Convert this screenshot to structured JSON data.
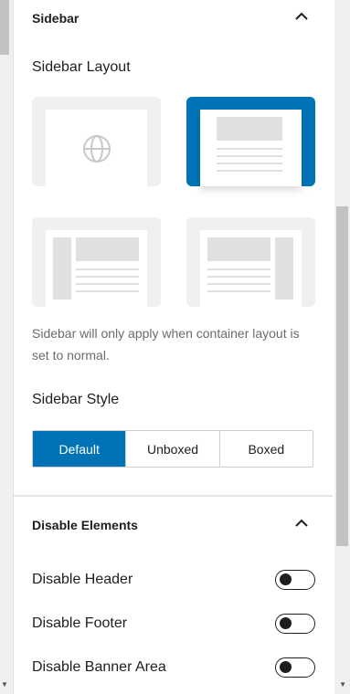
{
  "sidebar_section": {
    "title": "Sidebar",
    "layout_label": "Sidebar Layout",
    "layout_options": [
      {
        "name": "default",
        "icon": "globe-icon",
        "selected": false
      },
      {
        "name": "no-sidebar",
        "icon": "",
        "selected": true
      },
      {
        "name": "left-sidebar",
        "icon": "",
        "selected": false
      },
      {
        "name": "right-sidebar",
        "icon": "",
        "selected": false
      }
    ],
    "help_text": "Sidebar will only apply when container layout is set to normal.",
    "style_label": "Sidebar Style",
    "style_options": [
      "Default",
      "Unboxed",
      "Boxed"
    ],
    "style_selected": "Default"
  },
  "disable_section": {
    "title": "Disable Elements",
    "items": [
      {
        "label": "Disable Header",
        "enabled": false
      },
      {
        "label": "Disable Footer",
        "enabled": false
      },
      {
        "label": "Disable Banner Area",
        "enabled": false
      }
    ]
  },
  "colors": {
    "accent": "#0073b7",
    "card": "#f0f0f1",
    "placeholder": "#e0e0e2"
  }
}
